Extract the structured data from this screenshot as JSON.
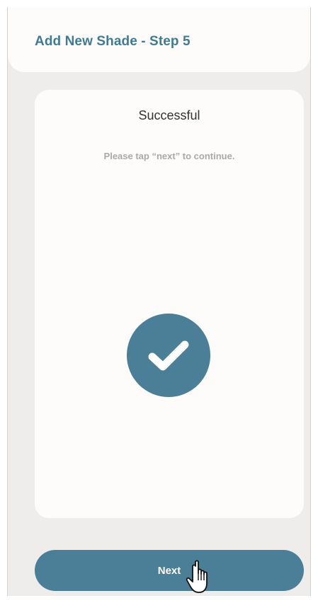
{
  "header": {
    "title": "Add New Shade - Step 5"
  },
  "card": {
    "title": "Successful",
    "subtitle": "Please tap “next” to continue.",
    "status_icon": "checkmark-circle-icon"
  },
  "footer": {
    "next_label": "Next"
  },
  "cursor_icon": "hand-pointer-icon",
  "colors": {
    "accent": "#4b7f97",
    "title_text": "#3f7b94",
    "background": "#efedeb",
    "surface": "#fdfcfb"
  }
}
